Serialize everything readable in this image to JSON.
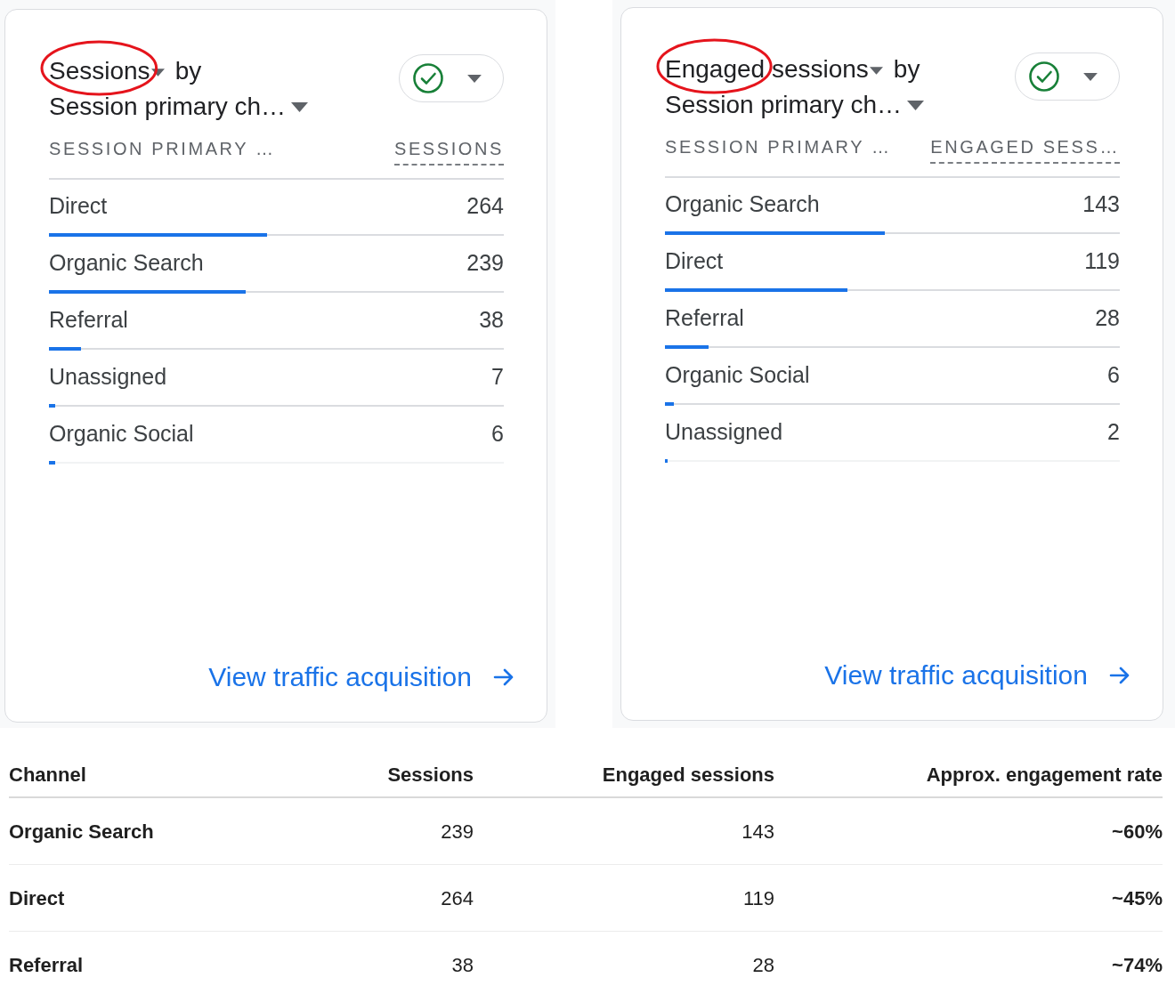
{
  "cards": [
    {
      "title_words": [
        {
          "text": "Sessions",
          "circled": true
        }
      ],
      "by": "by",
      "dimension": "Session primary ch…",
      "columns": [
        "SESSION PRIMARY …",
        "SESSIONS"
      ],
      "rows": [
        {
          "label": "Direct",
          "value": "264",
          "level": 0.48
        },
        {
          "label": "Organic Search",
          "value": "239",
          "level": 0.433
        },
        {
          "label": "Referral",
          "value": "38",
          "level": 0.07
        },
        {
          "label": "Unassigned",
          "value": "7",
          "level": 0.014
        },
        {
          "label": "Organic Social",
          "value": "6",
          "level": 0.014
        }
      ],
      "link": "View traffic acquisition"
    },
    {
      "title_words": [
        {
          "text": "Engaged",
          "circled": true
        },
        {
          "text": "sessions",
          "circled": false
        }
      ],
      "by": "by",
      "dimension": "Session primary ch…",
      "columns": [
        "SESSION PRIMARY …",
        "ENGAGED SESS…"
      ],
      "rows": [
        {
          "label": "Organic Search",
          "value": "143",
          "level": 0.484
        },
        {
          "label": "Direct",
          "value": "119",
          "level": 0.402
        },
        {
          "label": "Referral",
          "value": "28",
          "level": 0.096
        },
        {
          "label": "Organic Social",
          "value": "6",
          "level": 0.02
        },
        {
          "label": "Unassigned",
          "value": "2",
          "level": 0.006
        }
      ],
      "link": "View traffic acquisition"
    }
  ],
  "table": {
    "columns": [
      "Channel",
      "Sessions",
      "Engaged sessions",
      "Approx. engagement rate"
    ],
    "rows": [
      [
        "Organic Search",
        "239",
        "143",
        "~60%"
      ],
      [
        "Direct",
        "264",
        "119",
        "~45%"
      ],
      [
        "Referral",
        "38",
        "28",
        "~74%"
      ]
    ]
  }
}
